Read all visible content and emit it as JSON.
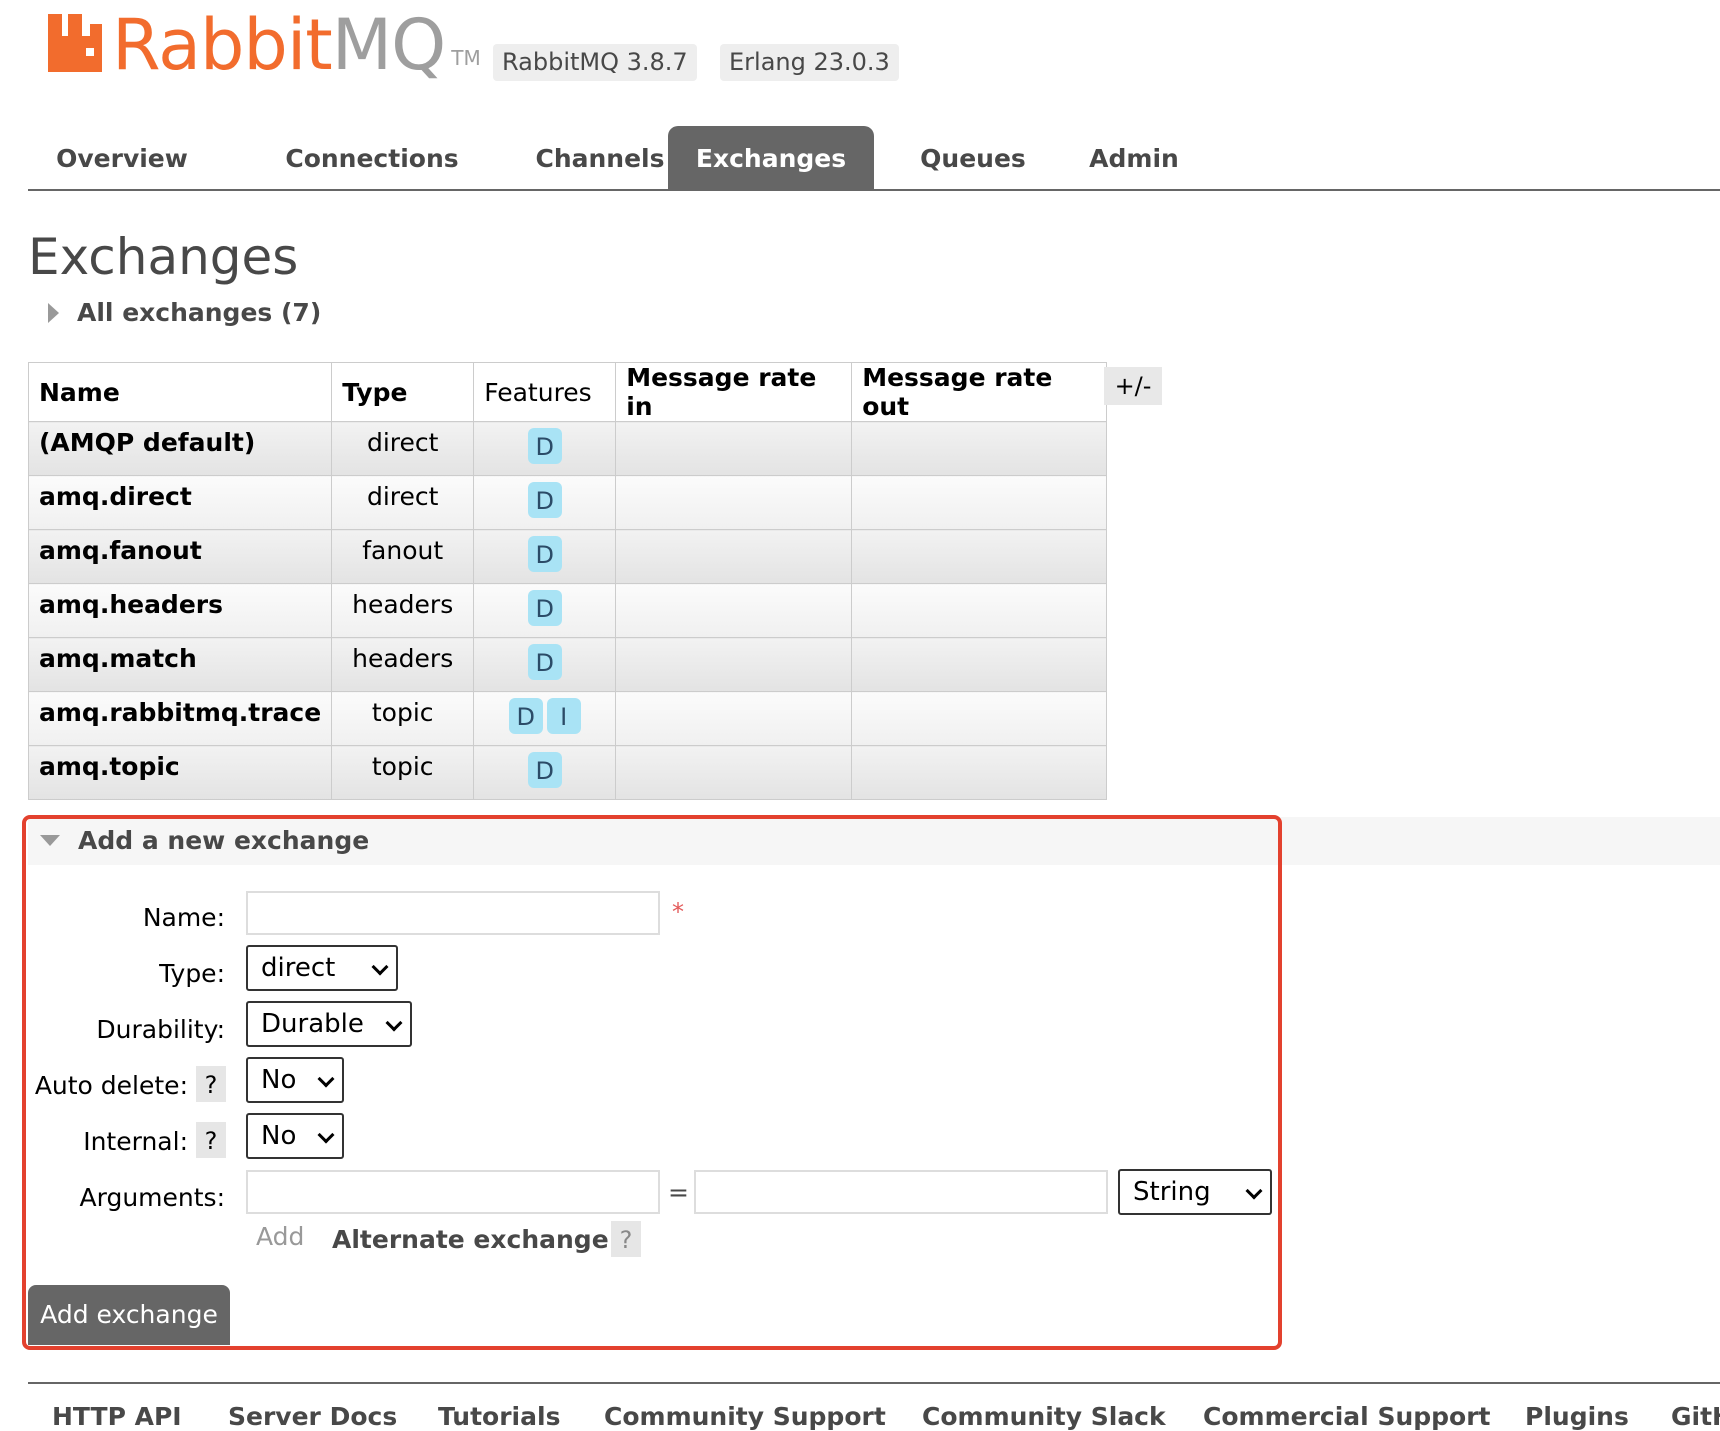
{
  "logo": {
    "rabbit": "Rabbit",
    "mq": "MQ",
    "tm": "TM"
  },
  "versions": {
    "rabbitmq": "RabbitMQ 3.8.7",
    "erlang": "Erlang 23.0.3"
  },
  "nav": {
    "tabs": [
      "Overview",
      "Connections",
      "Channels",
      "Exchanges",
      "Queues",
      "Admin"
    ],
    "active": "Exchanges"
  },
  "page": {
    "title": "Exchanges",
    "all_exchanges": "All exchanges (7)"
  },
  "table": {
    "headers": {
      "name": "Name",
      "type": "Type",
      "features": "Features",
      "rate_in": "Message rate in",
      "rate_out": "Message rate out"
    },
    "toggle_columns": "+/-",
    "rows": [
      {
        "name": "(AMQP default)",
        "type": "direct",
        "features": [
          "D"
        ]
      },
      {
        "name": "amq.direct",
        "type": "direct",
        "features": [
          "D"
        ]
      },
      {
        "name": "amq.fanout",
        "type": "fanout",
        "features": [
          "D"
        ]
      },
      {
        "name": "amq.headers",
        "type": "headers",
        "features": [
          "D"
        ]
      },
      {
        "name": "amq.match",
        "type": "headers",
        "features": [
          "D"
        ]
      },
      {
        "name": "amq.rabbitmq.trace",
        "type": "topic",
        "features": [
          "D",
          "I"
        ]
      },
      {
        "name": "amq.topic",
        "type": "topic",
        "features": [
          "D"
        ]
      }
    ]
  },
  "add_exchange": {
    "heading": "Add a new exchange",
    "labels": {
      "name": "Name:",
      "type": "Type:",
      "durability": "Durability:",
      "auto_delete": "Auto delete:",
      "internal": "Internal:",
      "arguments": "Arguments:"
    },
    "required_marker": "*",
    "help": "?",
    "values": {
      "name": "",
      "type": "direct",
      "durability": "Durable",
      "auto_delete": "No",
      "internal": "No",
      "arg_key": "",
      "arg_value": "",
      "arg_type": "String"
    },
    "equals": "=",
    "add_hint": "Add",
    "alternate_exchange": "Alternate exchange",
    "submit": "Add exchange"
  },
  "footer": {
    "links": [
      "HTTP API",
      "Server Docs",
      "Tutorials",
      "Community Support",
      "Community Slack",
      "Commercial Support",
      "Plugins",
      "GitHub"
    ]
  },
  "colors": {
    "brand_orange": "#f26c2d",
    "nav_active": "#666666",
    "feature_badge": "#a9e3f5",
    "highlight_border": "#e3412e"
  }
}
